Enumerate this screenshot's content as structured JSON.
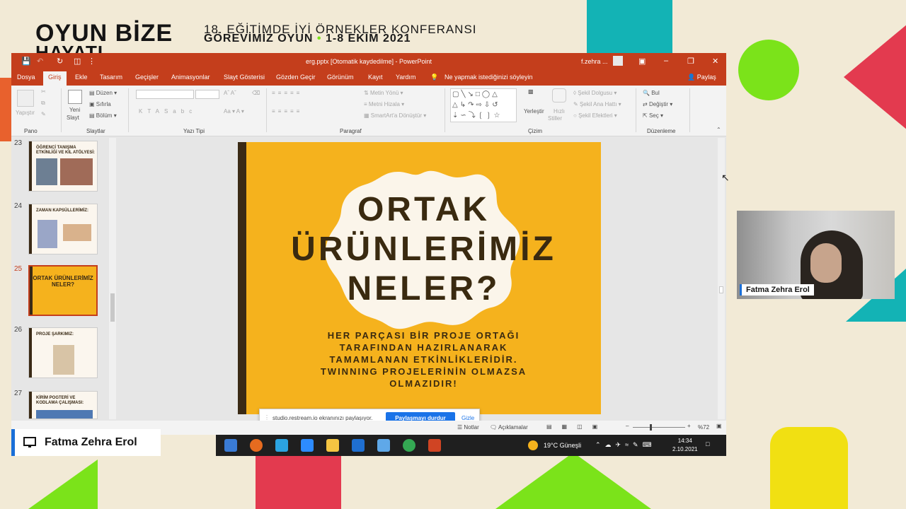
{
  "conference": {
    "logo_line1": "OYUN BİZE",
    "logo_line2": "HAYATI",
    "title": "18. EĞİTİMDE İYİ ÖRNEKLER KONFERANSI",
    "subtitle_a": "GÖREVİMİZ OYUN",
    "subtitle_dot": "•",
    "subtitle_b": "1-8 EKİM 2021"
  },
  "window": {
    "title": "erg.pptx [Otomatik kaydedilme] - PowerPoint",
    "user": "f.zehra ..."
  },
  "tabs": [
    "Dosya",
    "Giriş",
    "Ekle",
    "Tasarım",
    "Geçişler",
    "Animasyonlar",
    "Slayt Gösterisi",
    "Gözden Geçir",
    "Görünüm",
    "Kayıt",
    "Yardım"
  ],
  "active_tab": "Giriş",
  "tell_me": "Ne yapmak istediğinizi söyleyin",
  "share": "Paylaş",
  "ribbon": {
    "paste": "Yapıştır",
    "new_slide": "Yeni",
    "new_slide2": "Slayt",
    "layout": "Düzen",
    "reset": "Sıfırla",
    "section": "Bölüm",
    "text_direction": "Metin Yönü",
    "align_text": "Metni Hizala",
    "smartart": "SmartArt'a Dönüştür",
    "arrange": "Yerleştir",
    "quick_styles": "Hızlı",
    "quick_styles2": "Stiller",
    "shape_fill": "Şekil Dolgusu",
    "shape_outline": "Şekil Ana Hattı",
    "shape_effects": "Şekil Efektleri",
    "find": "Bul",
    "replace": "Değiştir",
    "select": "Seç",
    "groups": {
      "pano": "Pano",
      "slaytlar": "Slaytlar",
      "yazi_tipi": "Yazı Tipi",
      "paragraf": "Paragraf",
      "cizim": "Çizim",
      "duzenleme": "Düzenleme"
    }
  },
  "thumbnails": [
    {
      "num": "23",
      "title": "ÖĞRENCİ TANIŞMA ETKİNLİĞİ VE KİL ATÖLYESİ:"
    },
    {
      "num": "24",
      "title": "ZAMAN KAPSÜLLERİMİZ:"
    },
    {
      "num": "25",
      "title": "ORTAK ÜRÜNLERİMİZ NELER?"
    },
    {
      "num": "26",
      "title": "PROJE ŞARKIMIZ:"
    },
    {
      "num": "27",
      "title": "KİRİM POGTERİ VE KODLAMA ÇALIŞMASI:"
    }
  ],
  "slide": {
    "title_l1": "ORTAK",
    "title_l2": "ÜRÜNLERİMİZ",
    "title_l3": "NELER?",
    "body_l1": "HER PARÇASI BİR PROJE ORTAĞI",
    "body_l2": "TARAFINDAN HAZIRLANARAK",
    "body_l3": "TAMAMLANAN ETKİNLİKLERİDİR.",
    "body_l4": "TWINNING PROJELERİNİN OLMAZSA",
    "body_l5": "OLMAZIDIR!"
  },
  "screen_share": {
    "message": "studio.restream.io ekranınızı paylaşıyor.",
    "stop": "Paylaşmayı durdur",
    "hide": "Gizle"
  },
  "statusbar": {
    "notes": "Notlar",
    "comments": "Açıklamalar",
    "zoom": "%72"
  },
  "taskbar": {
    "weather": "19°C Güneşli",
    "time": "14:34",
    "date": "2.10.2021"
  },
  "participant": {
    "name": "Fatma Zehra Erol"
  },
  "presenter": {
    "name": "Fatma Zehra Erol"
  }
}
